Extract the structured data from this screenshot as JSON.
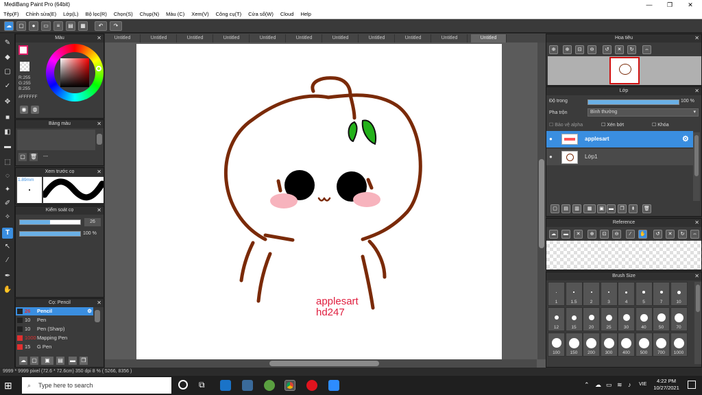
{
  "window": {
    "title": "MediBang Paint Pro (64bit)",
    "minimize": "—",
    "maximize": "❐",
    "close": "✕"
  },
  "menu": [
    "Tệp(F)",
    "Chỉnh sửa(E)",
    "Lớp(L)",
    "Bộ lọc(R)",
    "Chọn(S)",
    "Chụp(N)",
    "Màu (C)",
    "Xem(V)",
    "Công cụ(T)",
    "Cửa sổ(W)",
    "Cloud",
    "Help"
  ],
  "tabs": [
    "Untitled",
    "Untitled",
    "Untitled",
    "Untitled",
    "Untitled",
    "Untitled",
    "Untitled",
    "Untitled",
    "Untitled",
    "Untitled",
    "Untitled"
  ],
  "color_panel": {
    "title": "Màu",
    "r": "R:255",
    "g": "G:255",
    "b": "B:255",
    "hex": "#FFFFFF"
  },
  "palette_panel": {
    "title": "Bảng màu",
    "ellipsis": "---"
  },
  "brush_preview": {
    "title": "Xem trước cọ",
    "size": "1.89mm"
  },
  "brush_control": {
    "title": "Kiểm soát cọ",
    "size_value": "26",
    "opacity_value": "100 %",
    "size_fraction": 0.5,
    "opacity_fraction": 1.0
  },
  "brush_list": {
    "title": "Cọ: Pencil",
    "items": [
      {
        "size": "26",
        "name": "Pencil",
        "color": "#222222",
        "selected": true
      },
      {
        "size": "10",
        "name": "Pen",
        "color": "#222222",
        "selected": false
      },
      {
        "size": "10",
        "name": "Pen (Sharp)",
        "color": "#222222",
        "selected": false
      },
      {
        "size": "1000",
        "name": "Mapping Pen",
        "color": "#e03030",
        "selected": false
      },
      {
        "size": "15",
        "name": "G Pen",
        "color": "#e03030",
        "selected": false
      }
    ]
  },
  "navigator": {
    "title": "Hoa tiêu"
  },
  "layer_panel": {
    "title": "Lớp",
    "opacity_label": "Độ trong",
    "opacity_value": "100 %",
    "blend_label": "Pha trộn",
    "blend_value": "Bình thường",
    "protect_alpha": "Bảo vệ alpha",
    "clipping": "Xén bớt",
    "lock": "Khóa",
    "layers": [
      {
        "name": "applesart",
        "selected": true
      },
      {
        "name": "Lớp1",
        "selected": false
      }
    ]
  },
  "reference": {
    "title": "Reference"
  },
  "brush_size": {
    "title": "Brush Size",
    "sizes": [
      "1",
      "1.5",
      "2",
      "3",
      "4",
      "5",
      "7",
      "10",
      "12",
      "15",
      "20",
      "25",
      "30",
      "40",
      "50",
      "70",
      "100",
      "150",
      "200",
      "300",
      "400",
      "500",
      "700",
      "1000"
    ]
  },
  "canvas": {
    "watermark_line1": "applesart",
    "watermark_line2": "hd247",
    "stroke_color": "#7a2a08",
    "leaf_color": "#23b11a",
    "blush_color": "#f7b3bd"
  },
  "status": "9999 * 9999 pixel  (72.6 * 72.6cm)  350 dpi  8 %  ( 5266, 8356 )",
  "taskbar": {
    "search_placeholder": "Type here to search",
    "lang": "VIE",
    "time": "4:22 PM",
    "date": "10/27/2021"
  }
}
